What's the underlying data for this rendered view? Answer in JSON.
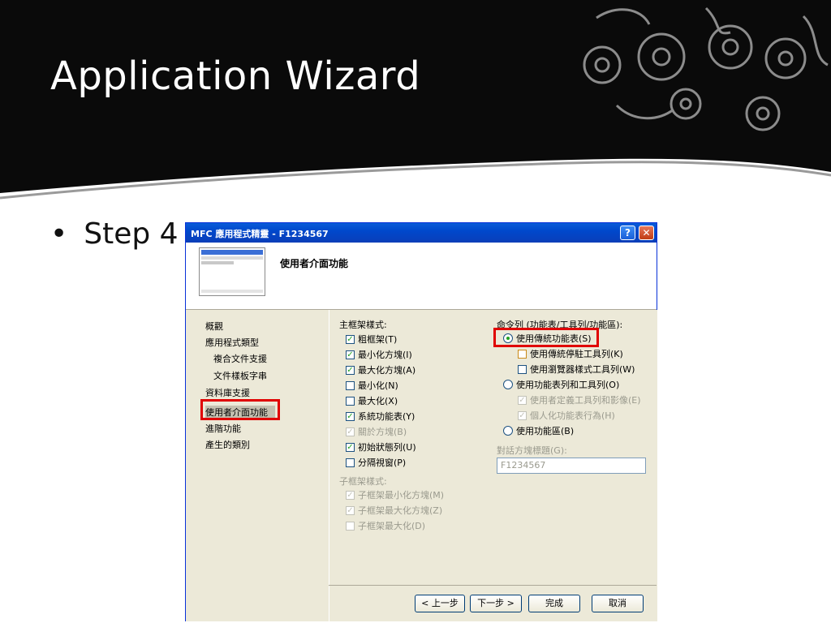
{
  "slide": {
    "title": "Application Wizard",
    "bullet": "Step 4"
  },
  "dialog": {
    "title": "MFC 應用程式精靈 - F1234567",
    "help_label": "?",
    "close_label": "✕",
    "heading": "使用者介面功能",
    "nav": [
      "概觀",
      "應用程式類型",
      "複合文件支援",
      "文件樣板字串",
      "資料庫支援",
      "使用者介面功能",
      "進階功能",
      "產生的類別"
    ],
    "main_frame": {
      "label": "主框架樣式:",
      "options": [
        {
          "label": "粗框架(T)",
          "checked": true,
          "enabled": true
        },
        {
          "label": "最小化方塊(I)",
          "checked": true,
          "enabled": true
        },
        {
          "label": "最大化方塊(A)",
          "checked": true,
          "enabled": true
        },
        {
          "label": "最小化(N)",
          "checked": false,
          "enabled": true
        },
        {
          "label": "最大化(X)",
          "checked": false,
          "enabled": true
        },
        {
          "label": "系統功能表(Y)",
          "checked": true,
          "enabled": true
        },
        {
          "label": "關於方塊(B)",
          "checked": true,
          "enabled": false
        },
        {
          "label": "初始狀態列(U)",
          "checked": true,
          "enabled": true
        },
        {
          "label": "分隔視窗(P)",
          "checked": false,
          "enabled": true
        }
      ]
    },
    "child_frame": {
      "label": "子框架樣式:",
      "options": [
        {
          "label": "子框架最小化方塊(M)",
          "checked": true
        },
        {
          "label": "子框架最大化方塊(Z)",
          "checked": true
        },
        {
          "label": "子框架最大化(D)",
          "checked": false
        }
      ]
    },
    "command_bar": {
      "label": "命令列 (功能表/工具列/功能區):",
      "classic_menu": "使用傳統功能表(S)",
      "classic_docking_toolbar": "使用傳統停駐工具列(K)",
      "browser_toolbar": "使用瀏覽器樣式工具列(W)",
      "menubar_toolbar": "使用功能表列和工具列(O)",
      "user_defined": "使用者定義工具列和影像(E)",
      "personalized": "個人化功能表行為(H)",
      "ribbon": "使用功能區(B)"
    },
    "dialog_caption": {
      "label": "對話方塊標題(G):",
      "value": "F1234567"
    },
    "buttons": {
      "back": "< 上一步",
      "next": "下一步 >",
      "finish": "完成",
      "cancel": "取消"
    },
    "highlight_color": "#e00000"
  }
}
